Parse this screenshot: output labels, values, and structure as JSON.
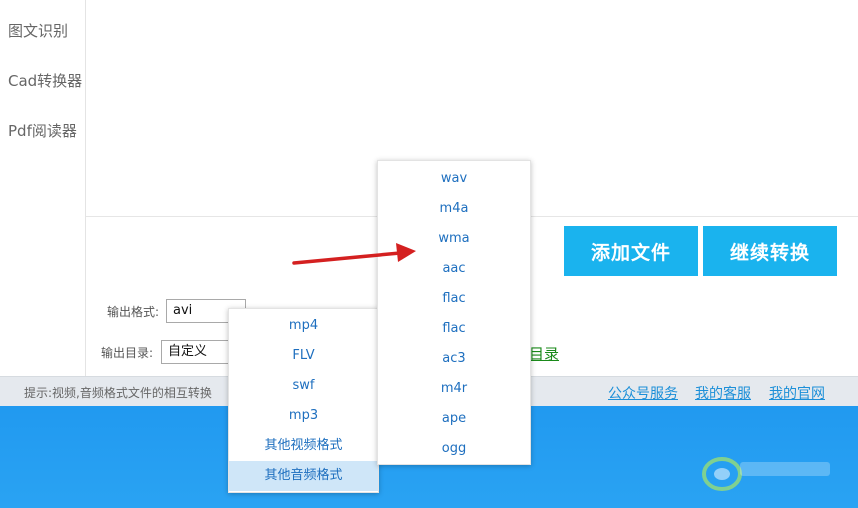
{
  "sidebar": {
    "items": [
      {
        "label": "图文识别"
      },
      {
        "label": "Cad转换器"
      },
      {
        "label": "Pdf阅读器"
      }
    ]
  },
  "toolbar": {
    "add_file_label": "添加文件",
    "continue_label": "继续转换"
  },
  "output": {
    "format_label": "输出格式:",
    "format_value": "avi",
    "dir_label": "输出目录:",
    "dir_value": "自定义",
    "open_dir_label": "目录"
  },
  "format_menu": {
    "items": [
      "mp4",
      "FLV",
      "swf",
      "mp3",
      "其他视频格式",
      "其他音频格式"
    ],
    "selected": "其他音频格式"
  },
  "audio_menu": {
    "items": [
      "wav",
      "m4a",
      "wma",
      "aac",
      "flac",
      "flac",
      "ac3",
      "m4r",
      "ape",
      "ogg"
    ]
  },
  "statusbar": {
    "hint": "提示:视频,音频格式文件的相互转换",
    "links": [
      "公众号服务",
      "我的客服",
      "我的官网"
    ]
  },
  "colors": {
    "accent": "#1ab3ee",
    "link": "#1c8fd8",
    "arrow": "#d42020"
  }
}
